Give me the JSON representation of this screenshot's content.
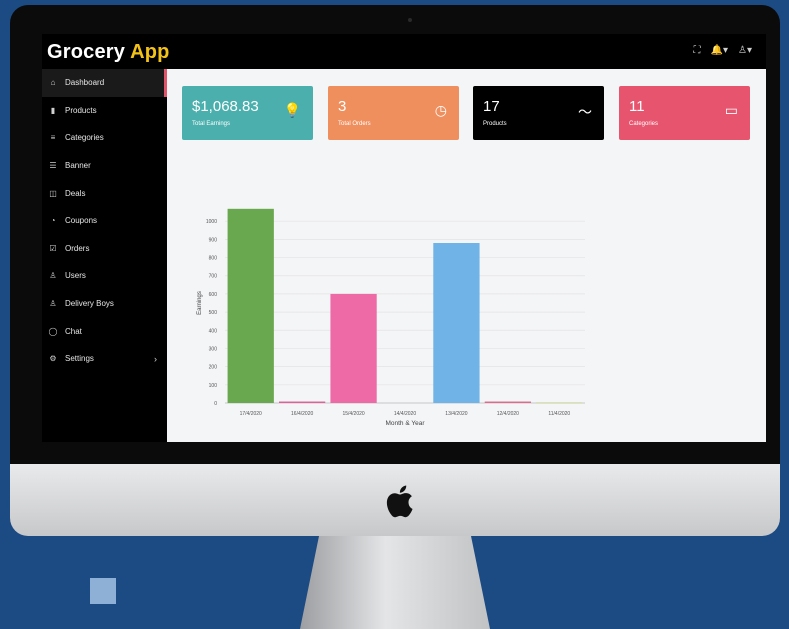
{
  "brand": {
    "name": "Grocery",
    "accent": "App"
  },
  "topbar_icons": [
    "fullscreen-icon",
    "bell-icon",
    "user-icon"
  ],
  "sidebar": {
    "items": [
      {
        "label": "Dashboard",
        "icon": "home-icon",
        "glyph": "⌂",
        "active": true
      },
      {
        "label": "Products",
        "icon": "bar-chart-icon",
        "glyph": "▮"
      },
      {
        "label": "Categories",
        "icon": "list-icon",
        "glyph": "≡"
      },
      {
        "label": "Banner",
        "icon": "menu-icon",
        "glyph": "☰"
      },
      {
        "label": "Deals",
        "icon": "tag-icon",
        "glyph": "◫"
      },
      {
        "label": "Coupons",
        "icon": "coupon-icon",
        "glyph": "◔"
      },
      {
        "label": "Orders",
        "icon": "orders-icon",
        "glyph": "☑"
      },
      {
        "label": "Users",
        "icon": "users-icon",
        "glyph": "♙"
      },
      {
        "label": "Delivery Boys",
        "icon": "delivery-icon",
        "glyph": "♙"
      },
      {
        "label": "Chat",
        "icon": "chat-icon",
        "glyph": "◯"
      },
      {
        "label": "Settings",
        "icon": "settings-icon",
        "glyph": "⚙",
        "has_chevron": true
      }
    ]
  },
  "cards": [
    {
      "value": "$1,068.83",
      "label": "Total Earnings",
      "color": "#4bb0ad",
      "icon": "lightbulb-icon",
      "glyph": "💡"
    },
    {
      "value": "3",
      "label": "Total Orders",
      "color": "#ef8f5e",
      "icon": "clock-icon",
      "glyph": "◷"
    },
    {
      "value": "17",
      "label": "Products",
      "color": "#000000",
      "icon": "trend-icon",
      "glyph": "〜"
    },
    {
      "value": "11",
      "label": "Categories",
      "color": "#e6556d",
      "icon": "folder-icon",
      "glyph": "▭"
    }
  ],
  "chart_data": {
    "type": "bar",
    "categories": [
      "17/4/2020",
      "16/4/2020",
      "15/4/2020",
      "14/4/2020",
      "13/4/2020",
      "12/4/2020",
      "11/4/2020"
    ],
    "values": [
      1068,
      8,
      600,
      0,
      880,
      8,
      5
    ],
    "colors": [
      "#6aa84f",
      "#e0609a",
      "#ee6aa7",
      "#e0e0e0",
      "#70b3e7",
      "#e06a8a",
      "#d7e3a0"
    ],
    "xlabel": "Month & Year",
    "ylabel": "Earnings",
    "ylim": [
      0,
      1100
    ],
    "yticks": [
      0,
      100,
      200,
      300,
      400,
      500,
      600,
      700,
      800,
      900,
      1000
    ],
    "grid": true
  }
}
